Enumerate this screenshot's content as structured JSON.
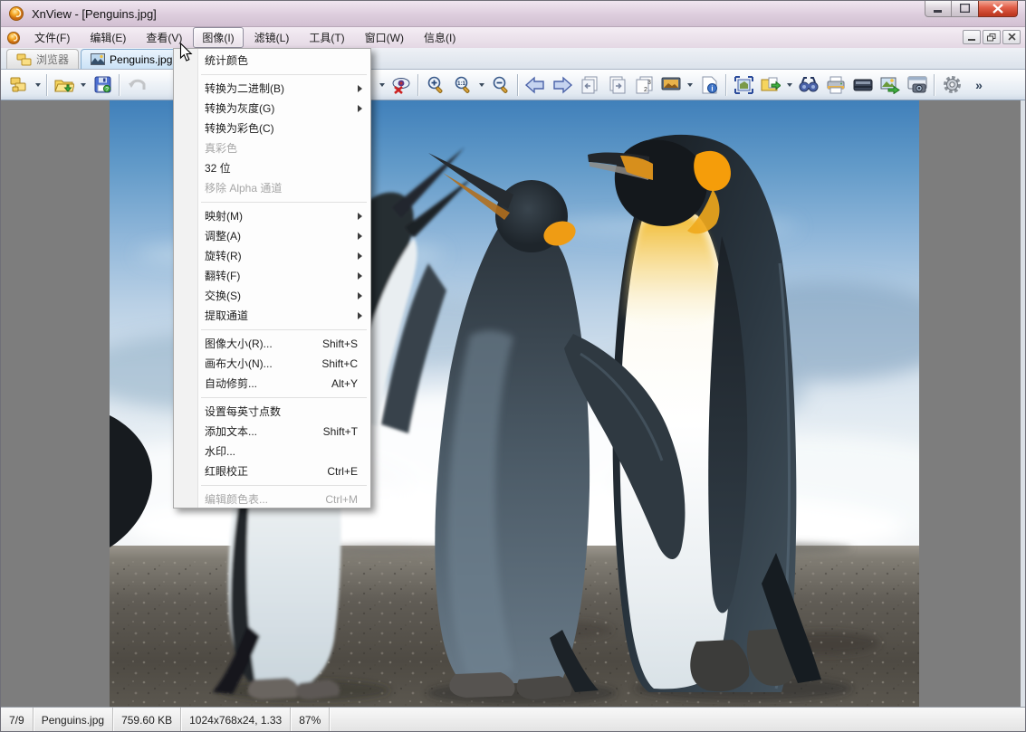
{
  "window": {
    "title": "XnView - [Penguins.jpg]",
    "controls": [
      "minimize",
      "maximize",
      "close"
    ]
  },
  "menubar": {
    "items": [
      {
        "label": "文件(F)"
      },
      {
        "label": "编辑(E)"
      },
      {
        "label": "查看(V)"
      },
      {
        "label": "图像(I)",
        "active": true
      },
      {
        "label": "滤镜(L)"
      },
      {
        "label": "工具(T)"
      },
      {
        "label": "窗口(W)"
      },
      {
        "label": "信息(I)"
      }
    ],
    "mdi_controls": [
      "minimize",
      "restore",
      "close"
    ]
  },
  "tabs": [
    {
      "label": "浏览器",
      "icon": "folders-icon",
      "active": false
    },
    {
      "label": "Penguins.jpg",
      "icon": "image-icon",
      "active": true
    }
  ],
  "toolbar": {
    "buttons": [
      "browser-panes",
      "open-file",
      "save",
      "undo",
      "hidden-under-menu-dropdown",
      "red-eye-removal",
      "zoom-in",
      "zoom-actual-size",
      "zoom-out",
      "previous-image",
      "next-image",
      "first-image",
      "last-image",
      "page-select",
      "slideshow",
      "image-info",
      "fullscreen",
      "move-copy",
      "search",
      "print",
      "acquire-scan",
      "convert",
      "screen-capture",
      "settings",
      "more-buttons"
    ]
  },
  "image_menu": {
    "items": [
      {
        "label": "统计颜色"
      },
      {
        "type": "separator"
      },
      {
        "label": "转换为二进制(B)",
        "submenu": true
      },
      {
        "label": "转换为灰度(G)",
        "submenu": true
      },
      {
        "label": "转换为彩色(C)"
      },
      {
        "label": "真彩色",
        "disabled": true
      },
      {
        "label": "32 位"
      },
      {
        "label": "移除 Alpha 通道",
        "disabled": true
      },
      {
        "type": "separator"
      },
      {
        "label": "映射(M)",
        "submenu": true
      },
      {
        "label": "调整(A)",
        "submenu": true
      },
      {
        "label": "旋转(R)",
        "submenu": true
      },
      {
        "label": "翻转(F)",
        "submenu": true
      },
      {
        "label": "交换(S)",
        "submenu": true
      },
      {
        "label": "提取通道",
        "submenu": true
      },
      {
        "type": "separator"
      },
      {
        "label": "图像大小(R)...",
        "shortcut": "Shift+S"
      },
      {
        "label": "画布大小(N)...",
        "shortcut": "Shift+C"
      },
      {
        "label": "自动修剪...",
        "shortcut": "Alt+Y"
      },
      {
        "type": "separator"
      },
      {
        "label": "设置每英寸点数"
      },
      {
        "label": "添加文本...",
        "shortcut": "Shift+T"
      },
      {
        "label": "水印..."
      },
      {
        "label": "红眼校正",
        "shortcut": "Ctrl+E"
      },
      {
        "type": "separator"
      },
      {
        "label": "编辑颜色表...",
        "shortcut": "Ctrl+M",
        "disabled": true
      }
    ]
  },
  "statusbar": {
    "cells": [
      "7/9",
      "Penguins.jpg",
      "759.60 KB",
      "1024x768x24, 1.33",
      "87%"
    ]
  },
  "colors": {
    "titlebar": "#ddcddd",
    "active_tab": "#cbe2f6",
    "close_button": "#c03a22",
    "viewer_background": "#7d7d7d",
    "penguin_orange": "#f59d0a",
    "menu_background": "#fdfdfd"
  }
}
